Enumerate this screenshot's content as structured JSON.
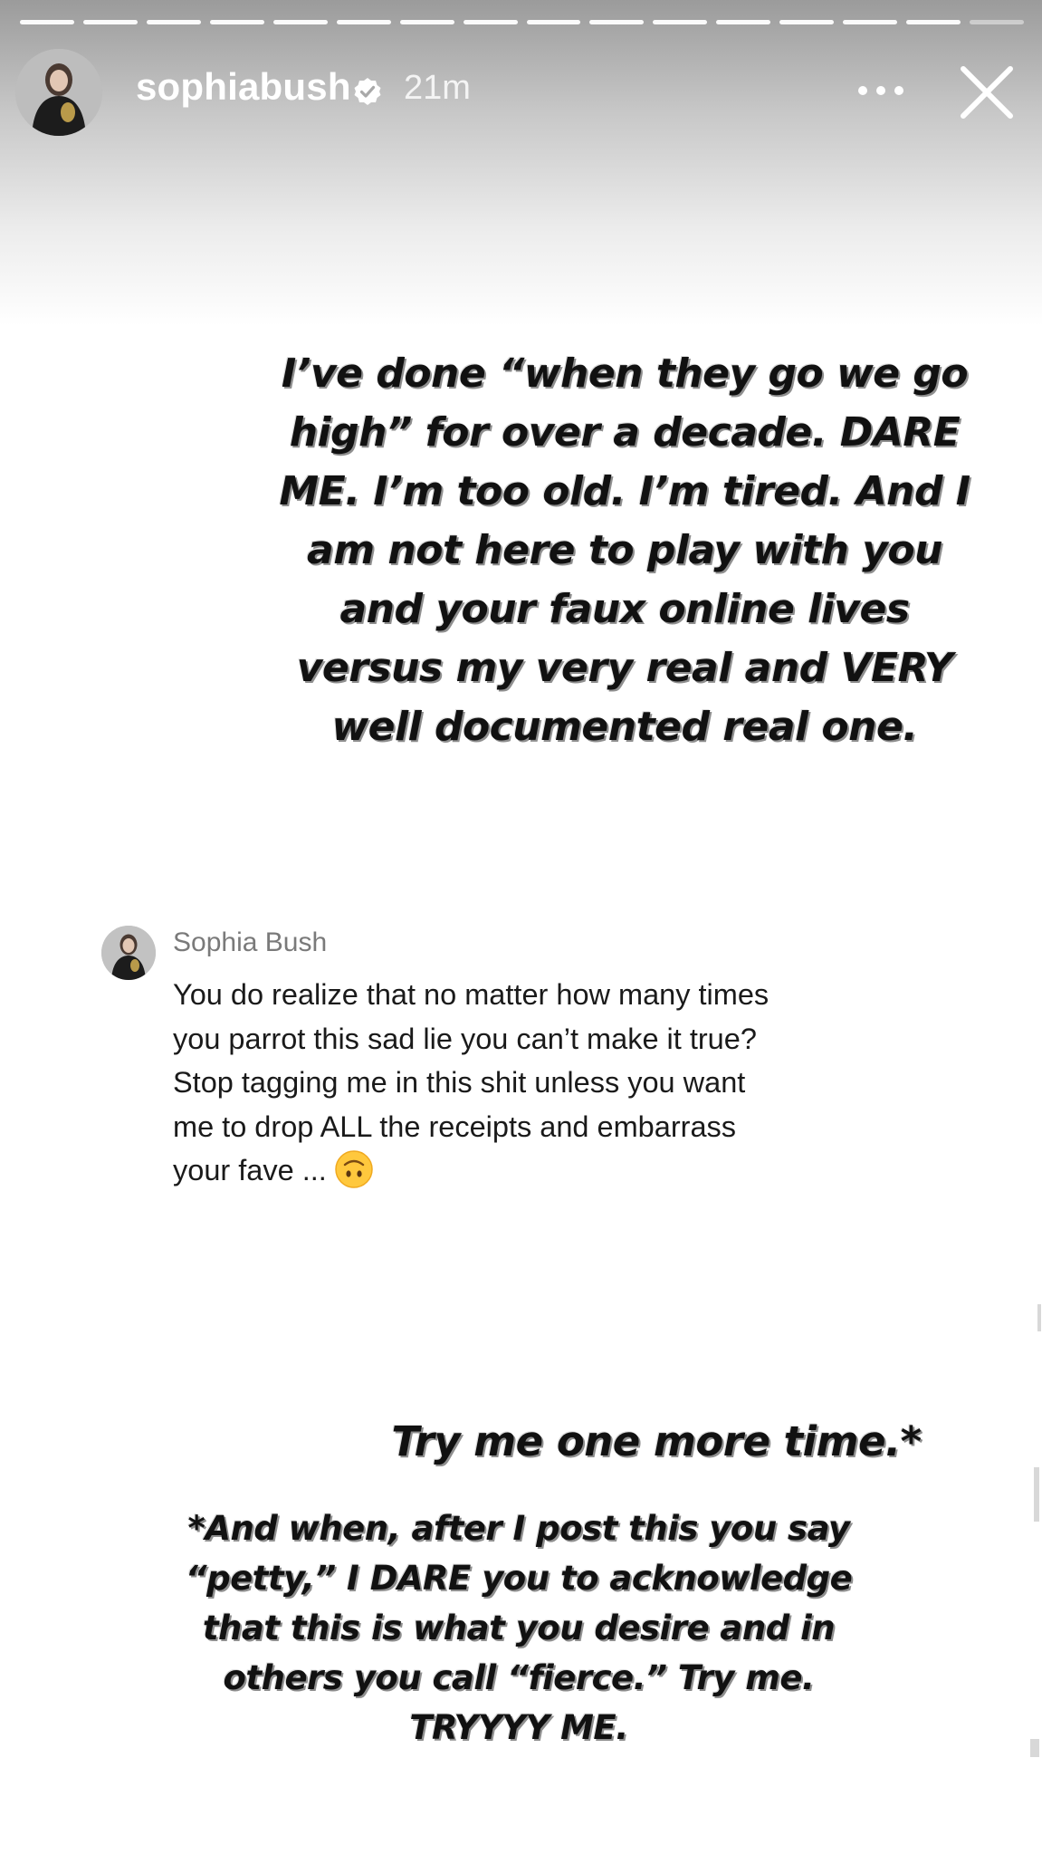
{
  "story": {
    "segments_total": 16,
    "segments_seen": 15
  },
  "header": {
    "username": "sophiabush",
    "timestamp": "21m",
    "icons": {
      "verified": "verified-badge-icon",
      "more": "more-options-icon",
      "close": "close-icon"
    }
  },
  "main_statement": {
    "lines": [
      "I’ve done “when they go we go",
      "high” for over a decade. DARE",
      "ME. I’m too old. I’m tired. And I",
      "am not here to play with you",
      "and your faux online lives",
      "versus my very real and VERY",
      "well documented real one."
    ]
  },
  "comment": {
    "author": "Sophia Bush",
    "lines": [
      "You do realize that no matter how many times",
      "you parrot this sad lie you can’t make it true?",
      "Stop tagging me in this shit unless you want",
      "me to drop ALL the receipts and embarrass",
      "your fave ..."
    ],
    "emoji": "upside-down-face-emoji"
  },
  "headline": {
    "text": "Try me one more time.*"
  },
  "footnote": {
    "lines": [
      "*And when, after I post this you say",
      "“petty,” I DARE  you to acknowledge",
      "that this is what you desire and in",
      "others you call “fierce.” Try me.",
      "TRYYYY ME."
    ]
  },
  "colors": {
    "text_primary": "#111111",
    "text_shadow": "#8f8f8f",
    "header_text": "#ffffff",
    "comment_author": "#7a7a7a"
  }
}
